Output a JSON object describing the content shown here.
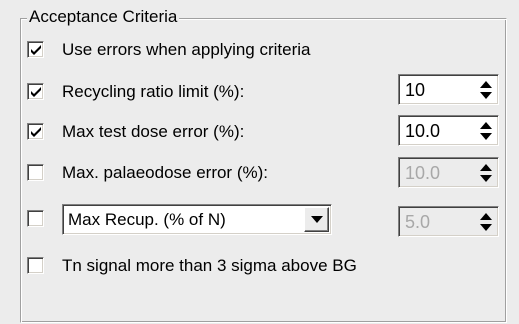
{
  "group": {
    "title": "Acceptance Criteria"
  },
  "rows": [
    {
      "label": "Use errors when applying criteria",
      "checked": true
    },
    {
      "label": "Recycling ratio limit (%):",
      "checked": true,
      "spin_value": "10",
      "spin_enabled": true
    },
    {
      "label": "Max test dose error (%):",
      "checked": true,
      "spin_value": "10.0",
      "spin_enabled": true
    },
    {
      "label": "Max. palaeodose error (%):",
      "checked": false,
      "spin_value": "10.0",
      "spin_enabled": false
    },
    {
      "combo_value": "Max Recup. (% of N)",
      "checked": false,
      "spin_value": "5.0",
      "spin_enabled": false
    },
    {
      "label": "Tn signal more than 3 sigma above BG",
      "checked": false
    }
  ],
  "icons": {
    "checkmark": "checkmark-icon",
    "spin_arrows": "spin-updown-icon",
    "dropdown": "chevron-down-icon"
  },
  "colors": {
    "background": "#ececec",
    "disabled_text": "#a8a8a8"
  }
}
